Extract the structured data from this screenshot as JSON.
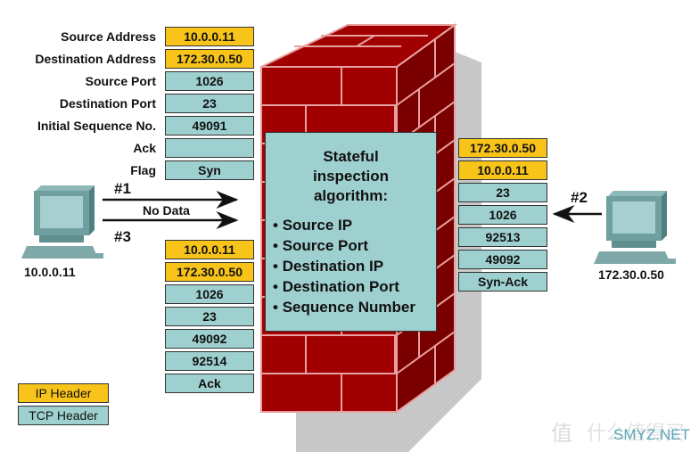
{
  "colors": {
    "ip_header": "#f8c41a",
    "tcp_header": "#9fd0d0",
    "brick": "#a00000",
    "mortar": "#e8a0a0"
  },
  "packet1": {
    "fields": [
      {
        "label": "Source Address",
        "value": "10.0.0.11",
        "type": "ip"
      },
      {
        "label": "Destination Address",
        "value": "172.30.0.50",
        "type": "ip"
      },
      {
        "label": "Source Port",
        "value": "1026",
        "type": "tcp"
      },
      {
        "label": "Destination Port",
        "value": "23",
        "type": "tcp"
      },
      {
        "label": "Initial Sequence No.",
        "value": "49091",
        "type": "tcp"
      },
      {
        "label": "Ack",
        "value": "",
        "type": "tcp"
      },
      {
        "label": "Flag",
        "value": "Syn",
        "type": "tcp"
      }
    ]
  },
  "packet2": {
    "values": [
      "172.30.0.50",
      "10.0.0.11",
      "23",
      "1026",
      "92513",
      "49092",
      "Syn-Ack"
    ]
  },
  "packet3": {
    "values": [
      "10.0.0.11",
      "172.30.0.50",
      "1026",
      "23",
      "49092",
      "92514",
      "Ack"
    ]
  },
  "arrows": {
    "step1": "#1",
    "step2": "#2",
    "step3": "#3",
    "no_data": "No Data"
  },
  "hosts": {
    "left": "10.0.0.11",
    "right": "172.30.0.50"
  },
  "algorithm": {
    "title_lines": [
      "Stateful",
      "inspection",
      "algorithm:"
    ],
    "items": [
      "Source IP",
      "Source Port",
      "Destination IP",
      "Destination Port",
      "Sequence Number"
    ]
  },
  "legend": {
    "ip": "IP Header",
    "tcp": "TCP Header"
  },
  "watermark": {
    "logo": "值",
    "text": "什么值得买",
    "site": "SMYZ.NET"
  }
}
